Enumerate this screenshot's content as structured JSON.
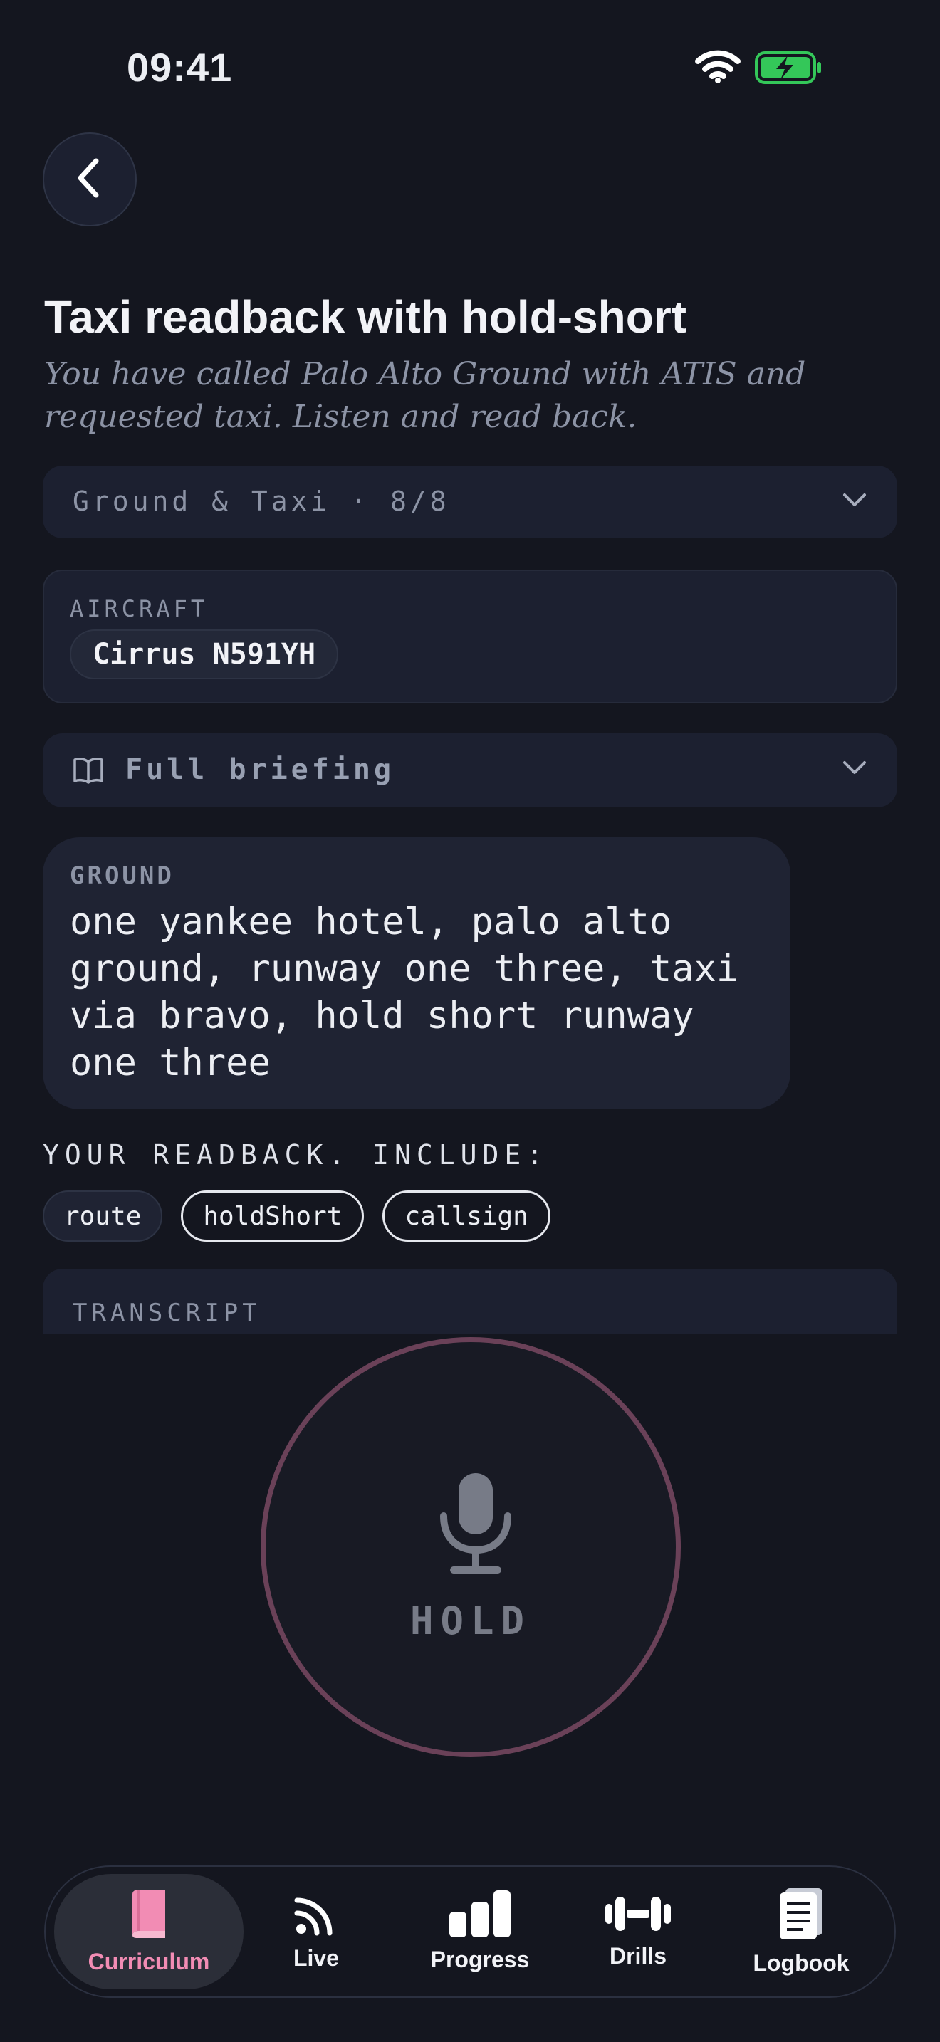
{
  "status_bar": {
    "time": "09:41"
  },
  "lesson": {
    "title": "Taxi readback with hold-short",
    "subtitle": "You have called Palo Alto Ground with ATIS and requested taxi. Listen and read back.",
    "module_select": "Ground & Taxi · 8/8"
  },
  "aircraft": {
    "label": "AIRCRAFT",
    "value": "Cirrus N591YH"
  },
  "briefing": {
    "label": "Full briefing"
  },
  "ground": {
    "label": "GROUND",
    "message": "one yankee hotel, palo alto ground, runway one three, taxi via bravo, hold short runway one three"
  },
  "readback": {
    "label": "YOUR READBACK. INCLUDE:",
    "items": [
      {
        "label": "route",
        "state": "done"
      },
      {
        "label": "holdShort",
        "state": "todo"
      },
      {
        "label": "callsign",
        "state": "todo"
      }
    ]
  },
  "transcript": {
    "label": "TRANSCRIPT"
  },
  "hold_button": {
    "label": "HOLD"
  },
  "tabs": [
    {
      "label": "Curriculum",
      "icon": "book-icon",
      "active": true
    },
    {
      "label": "Live",
      "icon": "broadcast-icon",
      "active": false
    },
    {
      "label": "Progress",
      "icon": "bar-chart-icon",
      "active": false
    },
    {
      "label": "Drills",
      "icon": "dumbbell-icon",
      "active": false
    },
    {
      "label": "Logbook",
      "icon": "logbook-icon",
      "active": false
    }
  ],
  "colors": {
    "accent": "#f28cb4",
    "battery": "#34c759",
    "ring": "#6a4158"
  }
}
